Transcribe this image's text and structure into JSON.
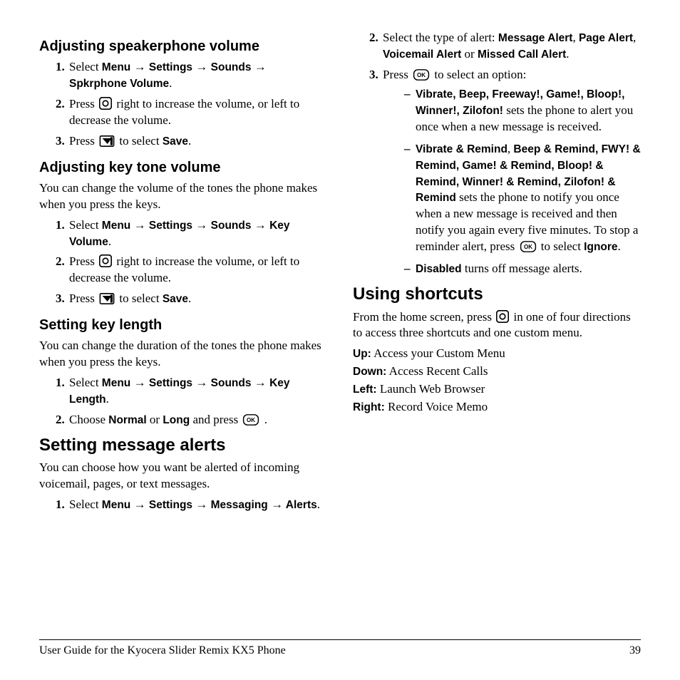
{
  "col1": {
    "sec1": {
      "title": "Adjusting speakerphone volume",
      "steps": {
        "s1a": "Select ",
        "s1b": "Menu ",
        "s1c": " Settings ",
        "s1d": " Sounds ",
        "s1e": " Spkrphone Volume",
        "s1f": ".",
        "s2a": "Press ",
        "s2b": " right to increase the volume, or left to decrease the volume.",
        "s3a": "Press ",
        "s3b": " to select ",
        "s3c": "Save",
        "s3d": "."
      }
    },
    "sec2": {
      "title": "Adjusting key tone volume",
      "intro": "You can change the volume of the tones the phone makes when you press the keys.",
      "steps": {
        "s1a": "Select ",
        "s1b": "Menu ",
        "s1c": " Settings ",
        "s1d": " Sounds ",
        "s1e": " Key Volume",
        "s1f": ".",
        "s2a": "Press ",
        "s2b": " right to increase the volume, or left to decrease the volume.",
        "s3a": "Press ",
        "s3b": " to select ",
        "s3c": "Save",
        "s3d": "."
      }
    },
    "sec3": {
      "title": "Setting key length",
      "intro": "You can change the duration of the tones the phone makes when you press the keys.",
      "steps": {
        "s1a": "Select ",
        "s1b": "Menu ",
        "s1c": " Settings ",
        "s1d": " Sounds ",
        "s1e": " Key Length",
        "s1f": ".",
        "s2a": "Choose ",
        "s2b": "Normal",
        "s2c": " or ",
        "s2d": "Long",
        "s2e": " and press ",
        "s2f": " ."
      }
    },
    "sec4": {
      "title": "Setting message alerts",
      "intro": "You can choose how you want be alerted of incoming voicemail, pages, or text messages.",
      "steps": {
        "s1a": "Select ",
        "s1b": "Menu ",
        "s1c": " Settings ",
        "s1d": " Messaging ",
        "s1e": " Alerts",
        "s1f": "."
      }
    }
  },
  "col2": {
    "cont": {
      "steps": {
        "s2a": "Select the type of alert: ",
        "s2b": "Message Alert",
        "s2c": ", ",
        "s2d": "Page Alert",
        "s2e": ", ",
        "s2f": "Voicemail Alert",
        "s2g": " or ",
        "s2h": "Missed Call Alert",
        "s2i": ".",
        "s3a": "Press ",
        "s3b": " to select an option:"
      },
      "bullets": {
        "b1a": "Vibrate, Beep, Freeway!, Game!, Bloop!, Winner!, Zilofon!",
        "b1b": " sets the phone to alert you once when a new message is received.",
        "b2a": "Vibrate & Remind",
        "b2b": ", ",
        "b2c": "Beep & Remind, FWY! & Remind, Game! & Remind, Bloop! & Remind, Winner! & Remind, Zilofon! & Remind",
        "b2d": " sets the phone to notify you once when a new message is received and then notify you again every five minutes. To stop a reminder alert, press ",
        "b2e": " to select ",
        "b2f": "Ignore",
        "b2g": ".",
        "b3a": "Disabled",
        "b3b": " turns off message alerts."
      }
    },
    "sec5": {
      "title": "Using shortcuts",
      "introA": "From the home screen, press ",
      "introB": " in one of four directions to access three shortcuts and one custom menu.",
      "up_l": "Up:",
      "up_t": " Access your Custom Menu",
      "down_l": "Down:",
      "down_t": " Access Recent Calls",
      "left_l": "Left:",
      "left_t": " Launch Web Browser",
      "right_l": "Right:",
      "right_t": " Record Voice Memo"
    }
  },
  "footer": {
    "left": "User Guide for the Kyocera Slider Remix KX5 Phone",
    "right": "39"
  },
  "glyphs": {
    "arrow": "→"
  }
}
